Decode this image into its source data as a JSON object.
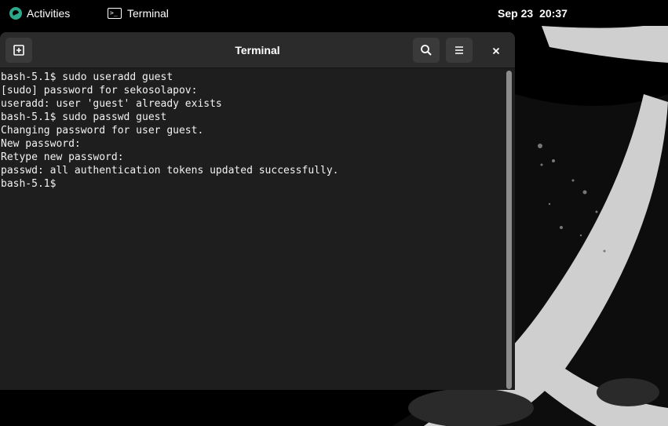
{
  "topbar": {
    "activities_label": "Activities",
    "app_label": "Terminal",
    "date": "Sep 23",
    "time": "20:37"
  },
  "window": {
    "title": "Terminal",
    "new_tab_icon": "new-tab-icon",
    "search_icon": "search-icon",
    "menu_icon": "hamburger-menu-icon",
    "close_icon": "close-icon"
  },
  "terminal": {
    "lines": [
      "bash-5.1$ sudo useradd guest",
      "[sudo] password for sekosolapov:",
      "useradd: user 'guest' already exists",
      "bash-5.1$ sudo passwd guest",
      "Changing password for user guest.",
      "New password:",
      "Retype new password:",
      "passwd: all authentication tokens updated successfully.",
      "bash-5.1$"
    ]
  },
  "colors": {
    "topbar_bg": "#000000",
    "headerbar_bg": "#2b2b2b",
    "terminal_bg": "#1e1e1e",
    "terminal_fg": "#f2f2f2",
    "accent_logo": "#2ea88a"
  }
}
